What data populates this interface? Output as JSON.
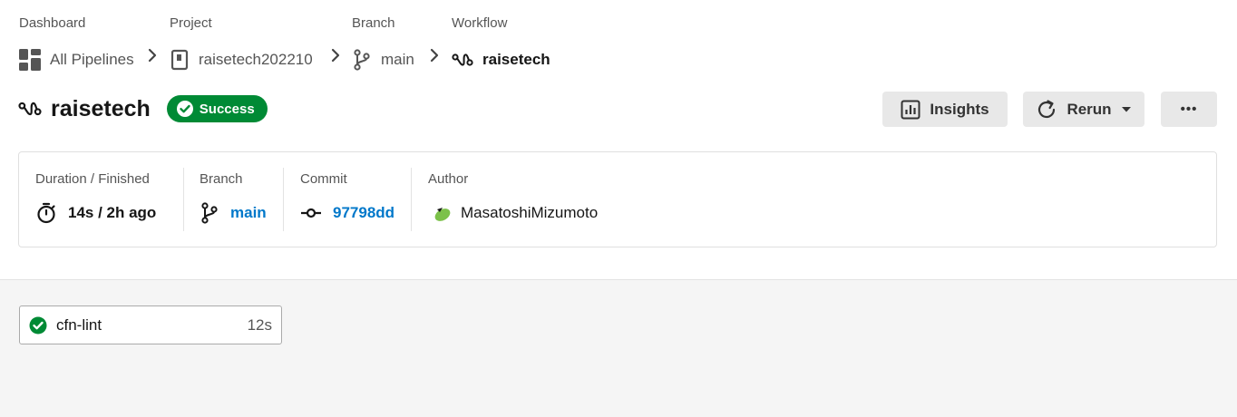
{
  "breadcrumb": {
    "dashboard": {
      "label": "Dashboard",
      "value": "All Pipelines"
    },
    "project": {
      "label": "Project",
      "value": "raisetech202210"
    },
    "branch": {
      "label": "Branch",
      "value": "main"
    },
    "workflow": {
      "label": "Workflow",
      "value": "raisetech"
    }
  },
  "header": {
    "title": "raisetech",
    "status": "Success",
    "insights_label": "Insights",
    "rerun_label": "Rerun",
    "more_label": "•••"
  },
  "summary": {
    "duration": {
      "label": "Duration / Finished",
      "value": "14s / 2h ago"
    },
    "branch": {
      "label": "Branch",
      "value": "main"
    },
    "commit": {
      "label": "Commit",
      "value": "97798dd"
    },
    "author": {
      "label": "Author",
      "value": "MasatoshiMizumoto"
    }
  },
  "jobs": [
    {
      "name": "cfn-lint",
      "duration": "12s",
      "status": "success"
    }
  ],
  "colors": {
    "success": "#008a35",
    "link": "#0078ca",
    "button_bg": "#e8e8e8"
  }
}
